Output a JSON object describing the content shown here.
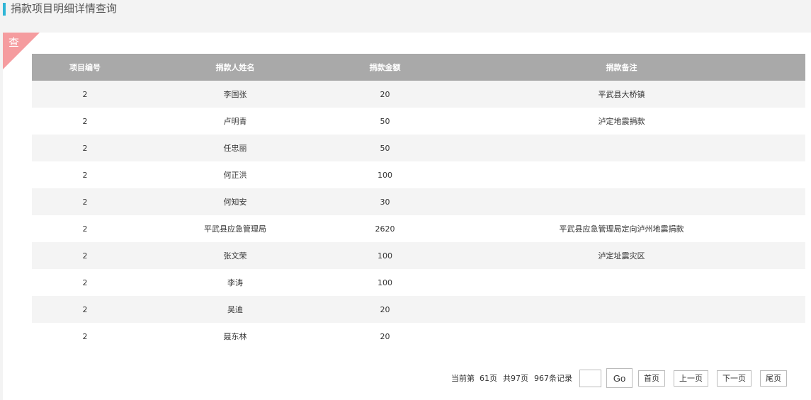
{
  "header": {
    "title": "捐款项目明细详情查询"
  },
  "corner": {
    "label": "查"
  },
  "table": {
    "columns": [
      "项目编号",
      "捐款人姓名",
      "捐款金额",
      "捐款备注"
    ],
    "rows": [
      [
        "2",
        "李国张",
        "20",
        "平武县大桥镇"
      ],
      [
        "2",
        "卢明青",
        "50",
        "泸定地震捐款"
      ],
      [
        "2",
        "任忠丽",
        "50",
        ""
      ],
      [
        "2",
        "何正洪",
        "100",
        ""
      ],
      [
        "2",
        "何知安",
        "30",
        ""
      ],
      [
        "2",
        "平武县应急管理局",
        "2620",
        "平武县应急管理局定向泸州地震捐款"
      ],
      [
        "2",
        "张文荣",
        "100",
        "泸定址震灾区"
      ],
      [
        "2",
        "李涛",
        "100",
        ""
      ],
      [
        "2",
        "吴迪",
        "20",
        ""
      ],
      [
        "2",
        "聂东林",
        "20",
        ""
      ]
    ]
  },
  "pager": {
    "current_prefix": "当前第",
    "current_page": "61页",
    "total_pages": "共97页",
    "total_records": "967条记录",
    "page_input_value": "",
    "go_label": "Go",
    "first_label": "首页",
    "prev_label": "上一页",
    "next_label": "下一页",
    "last_label": "尾页"
  }
}
